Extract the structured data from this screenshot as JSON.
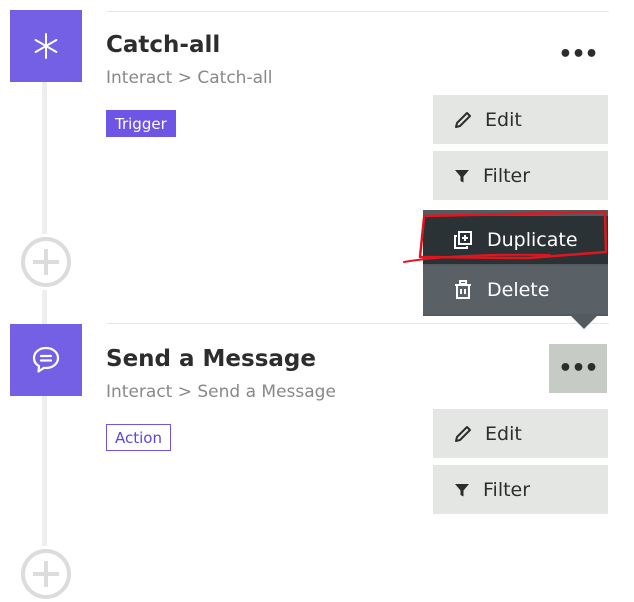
{
  "steps": [
    {
      "title": "Catch-all",
      "subtitle": "Interact > Catch-all",
      "badge": "Trigger",
      "icon": "asterisk-icon",
      "more_label": "•••",
      "edit_label": "Edit",
      "filter_label": "Filter"
    },
    {
      "title": "Send a Message",
      "subtitle": "Interact > Send a Message",
      "badge": "Action",
      "icon": "chat-bubble-icon",
      "more_label": "•••",
      "edit_label": "Edit",
      "filter_label": "Filter"
    }
  ],
  "menu": {
    "duplicate_label": "Duplicate",
    "delete_label": "Delete"
  },
  "colors": {
    "accent": "#7360e5",
    "button_bg": "#e3e6e3",
    "menu_bg": "#535b60",
    "menu_hover": "#2b3236",
    "annotation": "#e0161e"
  }
}
